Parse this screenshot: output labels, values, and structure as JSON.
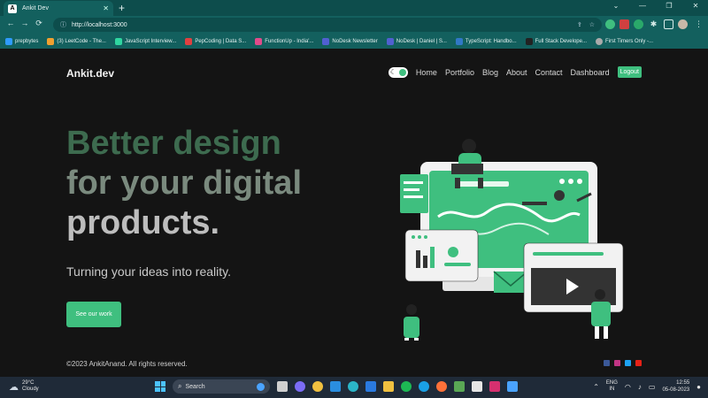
{
  "browser": {
    "tab_title": "Ankit Dev",
    "tab_favicon": "A",
    "url": "http://localhost:3000",
    "bookmarks": [
      {
        "label": "prepbytes",
        "color": "#2f9bff"
      },
      {
        "label": "(3) LeetCode - The...",
        "color": "#f0a030"
      },
      {
        "label": "JavaScript Interview...",
        "color": "#2fd6a0"
      },
      {
        "label": "PepCoding | Data S...",
        "color": "#e04040"
      },
      {
        "label": "FunctionUp - India'...",
        "color": "#e04b8a"
      },
      {
        "label": "NoDesk Newsletter",
        "color": "#5060d0"
      },
      {
        "label": "NoDesk | Daniel | S...",
        "color": "#5060d0"
      },
      {
        "label": "TypeScript: Handbo...",
        "color": "#3178c6"
      },
      {
        "label": "Full Stack Develope...",
        "color": "#222222"
      },
      {
        "label": "First Timers Only -...",
        "color": "#aaaaaa"
      }
    ]
  },
  "site": {
    "brand": "Ankit.dev",
    "nav": [
      "Home",
      "Portfolio",
      "Blog",
      "About",
      "Contact",
      "Dashboard"
    ],
    "logout": "Logout",
    "hero": {
      "line1": "Better design",
      "line2": "for your digital",
      "line3": "products."
    },
    "subtitle": "Turning your ideas into reality.",
    "cta": "See our work",
    "footer": "©2023 AnkitAnand. All rights reserved.",
    "accent": "#3fbf7f"
  },
  "taskbar": {
    "temp": "29°C",
    "condition": "Cloudy",
    "search": "Search",
    "lang1": "ENG",
    "lang2": "IN",
    "time": "12:55",
    "date": "05-08-2023"
  }
}
